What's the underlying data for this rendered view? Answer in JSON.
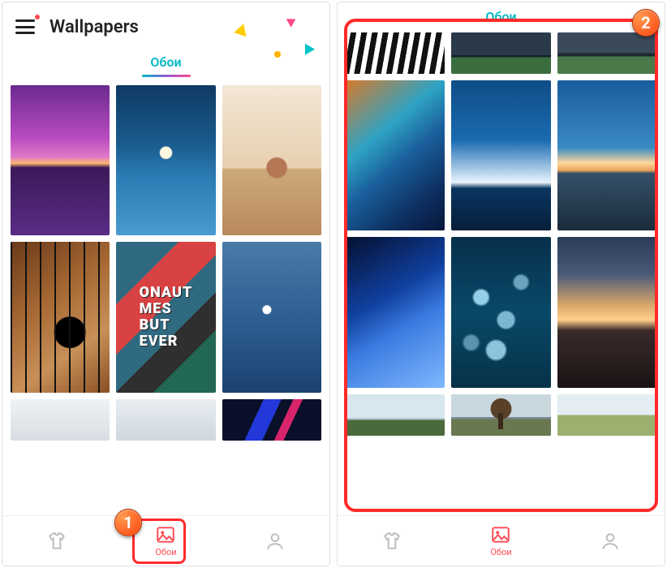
{
  "colors": {
    "accent_teal": "#00b9c6",
    "accent_red": "#ff4b55",
    "annotation": "#ff2a2a"
  },
  "annotations": {
    "marker1": "1",
    "marker2": "2"
  },
  "left": {
    "title": "Wallpapers",
    "tab": "Обои",
    "nav_wallpapers": "Обои",
    "thumbs": [
      "sunset-purple",
      "starfish-night",
      "girl-ukulele",
      "ukulele-wood",
      "graffiti-text",
      "seagull-ocean",
      "plain-light-1",
      "plain-light-2",
      "diagonal-stripes"
    ]
  },
  "right": {
    "tab": "Обои",
    "nav_wallpapers": "Обои",
    "thumbs": [
      "zebra-stripes",
      "hills-dusk-1",
      "hills-dusk-2",
      "aurora-gradient",
      "iceberg-blue",
      "horizon-sunset",
      "diagonal-blue",
      "bokeh-teal",
      "mountain-dusk",
      "grass-sky",
      "lone-tree",
      "meadow-sky"
    ]
  }
}
